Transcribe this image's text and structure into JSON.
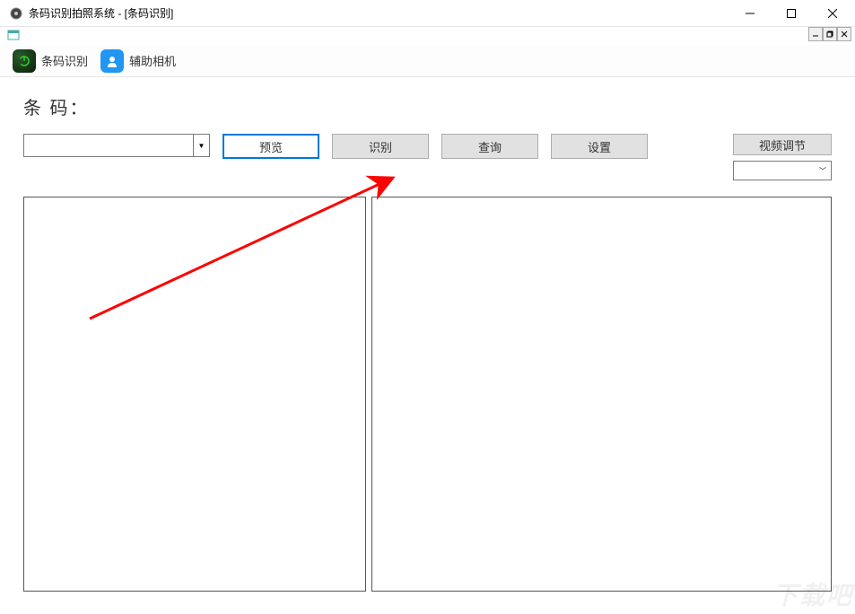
{
  "titlebar": {
    "title": "条码识别拍照系统 - [条码识别]"
  },
  "toolbar": {
    "item1_label": "条码识别",
    "item2_label": "辅助相机"
  },
  "main": {
    "section_label": "条 码：",
    "combo_value": "",
    "btn_preview": "预览",
    "btn_recognize": "识别",
    "btn_query": "查询",
    "btn_settings": "设置",
    "btn_video_adjust": "视频调节",
    "video_select_value": ""
  },
  "watermark": "下载吧"
}
